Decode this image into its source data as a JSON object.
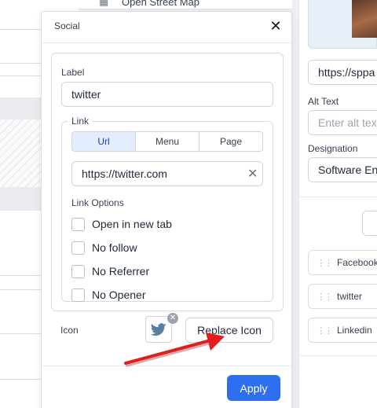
{
  "background": {
    "map_item_label": "Open Street Map"
  },
  "right_panel": {
    "url_value": "https://sppa",
    "alt_text_label": "Alt Text",
    "alt_text_placeholder": "Enter alt tex",
    "designation_label": "Designation",
    "designation_value": "Software Eng",
    "socials": [
      "Facebook",
      "twitter",
      "Linkedin"
    ]
  },
  "popover": {
    "title": "Social",
    "close_icon": "close-icon",
    "label_field": {
      "label": "Label",
      "value": "twitter"
    },
    "link": {
      "legend": "Link",
      "tabs": [
        {
          "label": "Url",
          "active": true
        },
        {
          "label": "Menu",
          "active": false
        },
        {
          "label": "Page",
          "active": false
        }
      ],
      "url_value": "https://twitter.com",
      "options_label": "Link Options",
      "options": [
        {
          "label": "Open in new tab",
          "checked": false
        },
        {
          "label": "No follow",
          "checked": false
        },
        {
          "label": "No Referrer",
          "checked": false
        },
        {
          "label": "No Opener",
          "checked": false
        }
      ]
    },
    "icon_field": {
      "label": "Icon",
      "icon": "twitter-bird-icon",
      "replace_label": "Replace Icon"
    },
    "apply_label": "Apply"
  },
  "colors": {
    "primary": "#2e6ff0",
    "tab_active_bg": "#e3ecfb",
    "twitter_icon": "#5b7f9e",
    "annotation_arrow": "#e11d1d"
  }
}
